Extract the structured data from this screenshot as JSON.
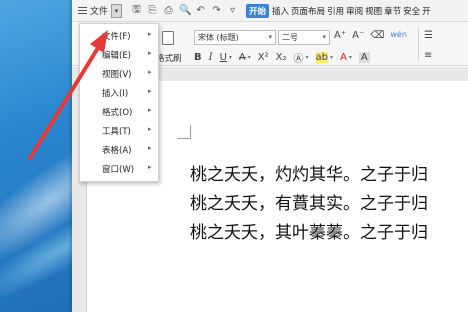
{
  "menubar": {
    "file_label": "文件",
    "tabs": [
      "开始",
      "插入",
      "页面布局",
      "引用",
      "审阅",
      "视图",
      "章节",
      "安全",
      "开"
    ]
  },
  "ribbon": {
    "font_name": "宋体 (标题)",
    "font_size": "二号",
    "format_painter": "格式刷"
  },
  "file_menu": {
    "items": [
      {
        "label": "文件(F)"
      },
      {
        "label": "编辑(E)"
      },
      {
        "label": "视图(V)"
      },
      {
        "label": "插入(I)"
      },
      {
        "label": "格式(O)"
      },
      {
        "label": "工具(T)"
      },
      {
        "label": "表格(A)"
      },
      {
        "label": "窗口(W)"
      }
    ]
  },
  "document": {
    "lines": [
      "桃之夭夭，灼灼其华。之子于归",
      "桃之夭夭，有蕡其实。之子于归",
      "桃之夭夭，其叶蓁蓁。之子于归"
    ]
  },
  "colors": {
    "active_tab": "#3d7fd9",
    "annotation_arrow": "#e53935",
    "desktop": "#2a86cf"
  }
}
